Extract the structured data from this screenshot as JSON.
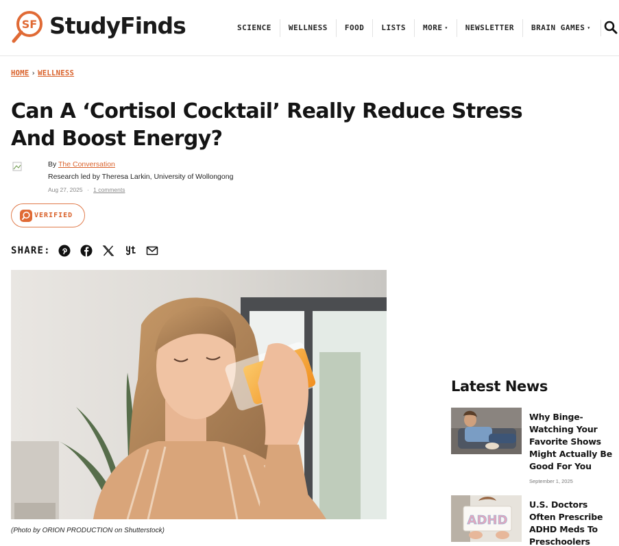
{
  "header": {
    "logo_text": "StudyFinds",
    "logo_mark": "SF",
    "nav": [
      {
        "label": "SCIENCE",
        "dropdown": false
      },
      {
        "label": "WELLNESS",
        "dropdown": false
      },
      {
        "label": "FOOD",
        "dropdown": false
      },
      {
        "label": "LISTS",
        "dropdown": false
      },
      {
        "label": "MORE",
        "dropdown": true
      },
      {
        "label": "NEWSLETTER",
        "dropdown": false
      },
      {
        "label": "BRAIN GAMES",
        "dropdown": true
      }
    ],
    "search_icon": "search-icon"
  },
  "breadcrumb": {
    "home": "HOME",
    "separator": "›",
    "section": "WELLNESS"
  },
  "article": {
    "title": "Can A ‘Cortisol Cocktail’ Really Reduce Stress And Boost Energy?",
    "by_prefix": "By",
    "author": "The Conversation",
    "research_line": "Research led by Theresa Larkin, University of Wollongong",
    "date": "Aug 27, 2025",
    "meta_separator": "·",
    "comments": "1 comments",
    "verified_label": "VERIFIED",
    "share_label": "SHARE:",
    "share_icons": [
      "pinterest-icon",
      "facebook-icon",
      "x-icon",
      "yummly-icon",
      "email-icon"
    ],
    "image_caption": "(Photo by ORION PRODUCTION on Shutterstock)"
  },
  "latest_news": {
    "title": "Latest News",
    "items": [
      {
        "headline": "Why Binge-Watching Your Favorite Shows Might Actually Be Good For You",
        "date": "September 1, 2025"
      },
      {
        "headline": "U.S. Doctors Often Prescribe ADHD Meds To Preschoolers",
        "date": "",
        "thumb_text": "ADHD"
      }
    ]
  },
  "colors": {
    "accent": "#d9612a",
    "text": "#141414",
    "border": "#e2e2e2"
  }
}
